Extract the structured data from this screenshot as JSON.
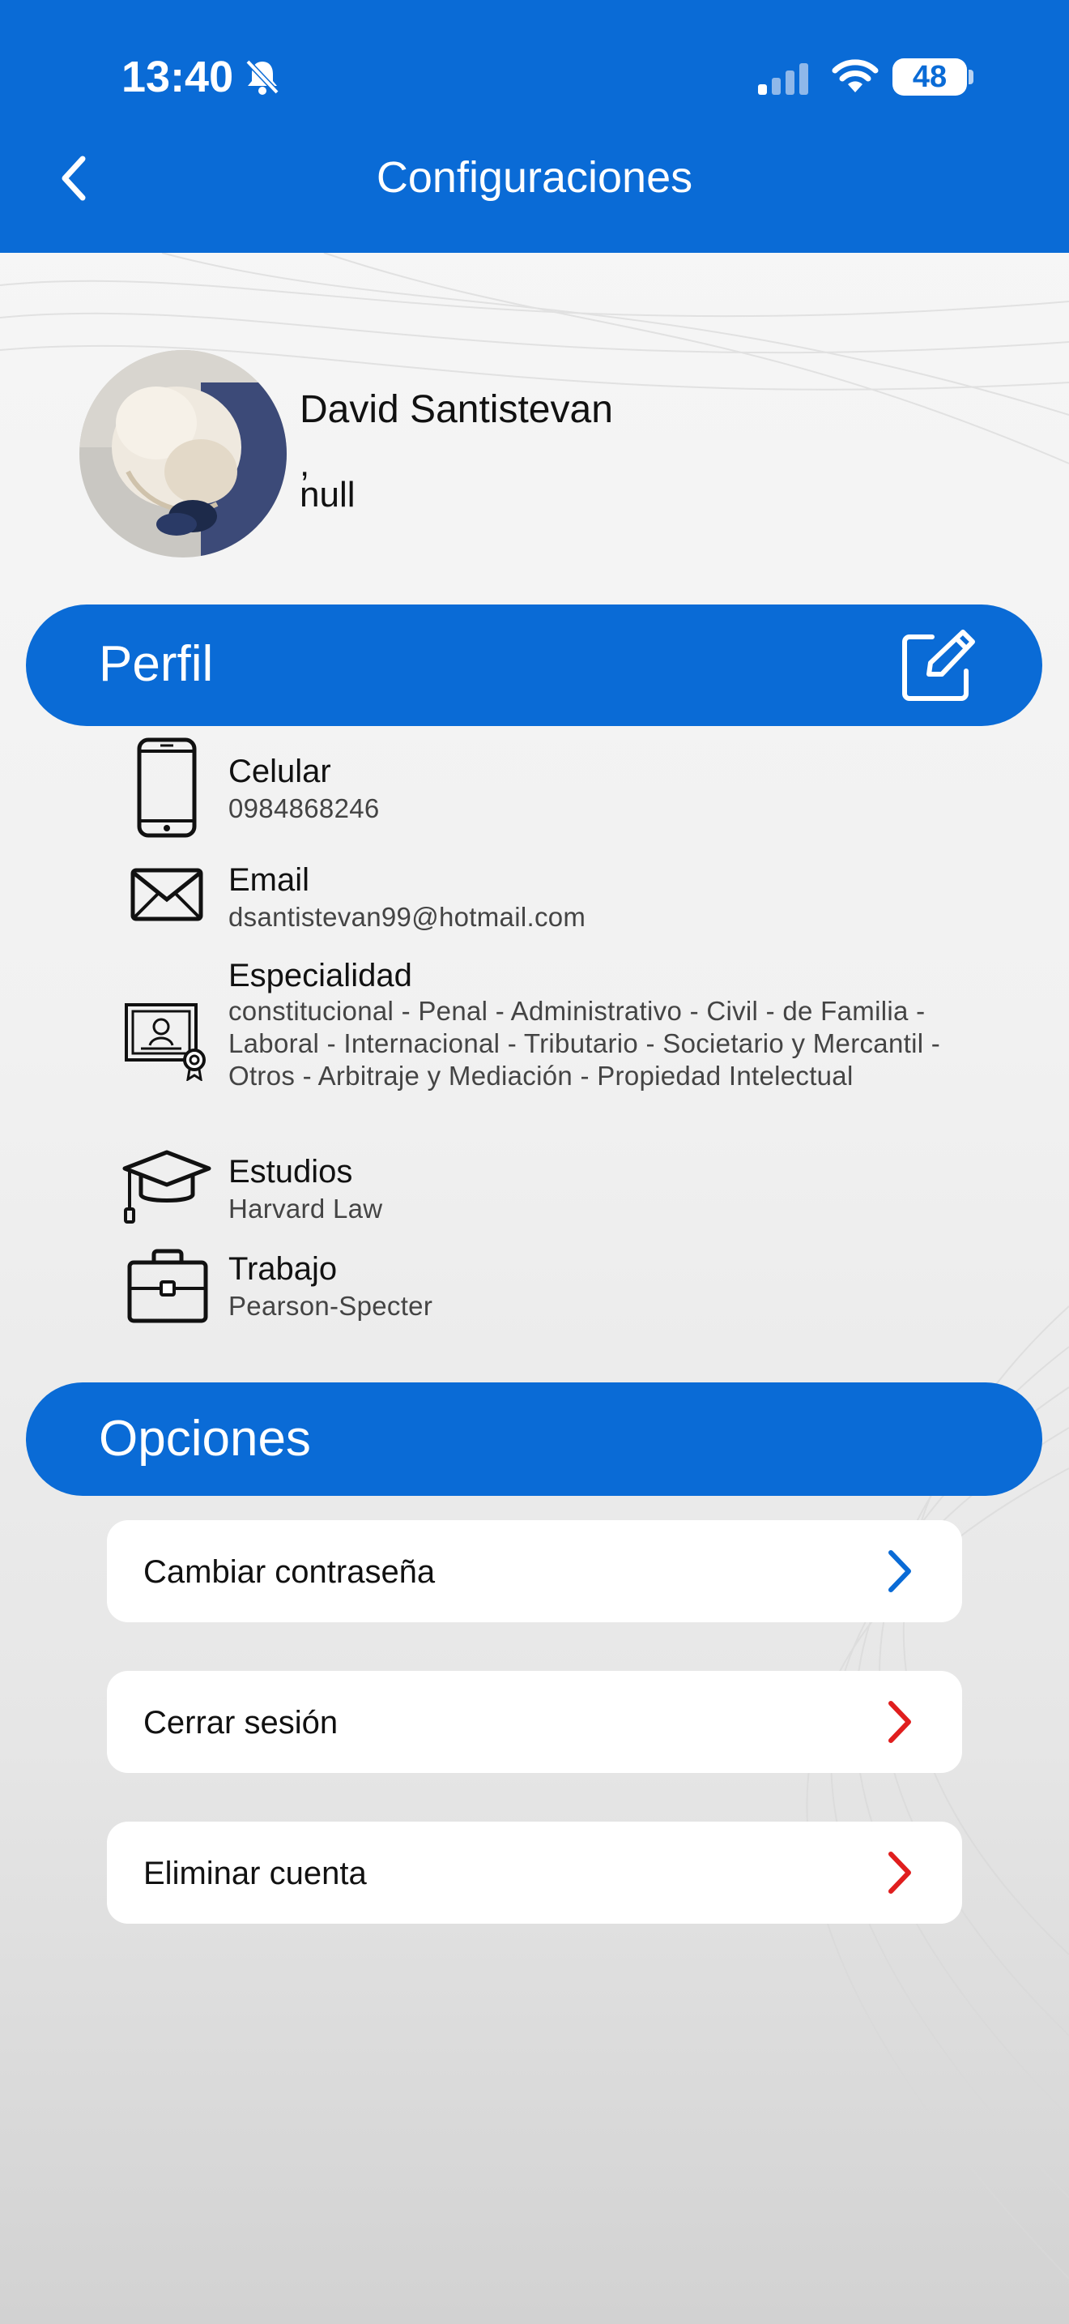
{
  "status": {
    "time": "13:40",
    "battery": "48"
  },
  "header": {
    "title": "Configuraciones"
  },
  "user": {
    "name": "David Santistevan",
    "line2": ",",
    "line3": "null"
  },
  "perfil": {
    "title": "Perfil",
    "items": [
      {
        "icon": "phone-icon",
        "label": "Celular",
        "value": "0984868246"
      },
      {
        "icon": "mail-icon",
        "label": "Email",
        "value": "dsantistevan99@hotmail.com"
      },
      {
        "icon": "certificate-icon",
        "label": "Especialidad",
        "value": "constitucional - Penal - Administrativo - Civil - de Familia - Laboral - Internacional - Tributario - Societario y Mercantil - Otros - Arbitraje y Mediación - Propiedad Intelectual"
      },
      {
        "icon": "graduation-cap-icon",
        "label": "Estudios",
        "value": "Harvard Law"
      },
      {
        "icon": "briefcase-icon",
        "label": "Trabajo",
        "value": "Pearson-Specter"
      }
    ]
  },
  "opciones": {
    "title": "Opciones",
    "items": [
      {
        "label": "Cambiar contraseña",
        "chevron_color": "#0a6bd6"
      },
      {
        "label": "Cerrar sesión",
        "chevron_color": "#e01e1e"
      },
      {
        "label": "Eliminar cuenta",
        "chevron_color": "#e01e1e"
      }
    ]
  },
  "colors": {
    "accent": "#0a6bd6",
    "danger": "#e01e1e"
  }
}
